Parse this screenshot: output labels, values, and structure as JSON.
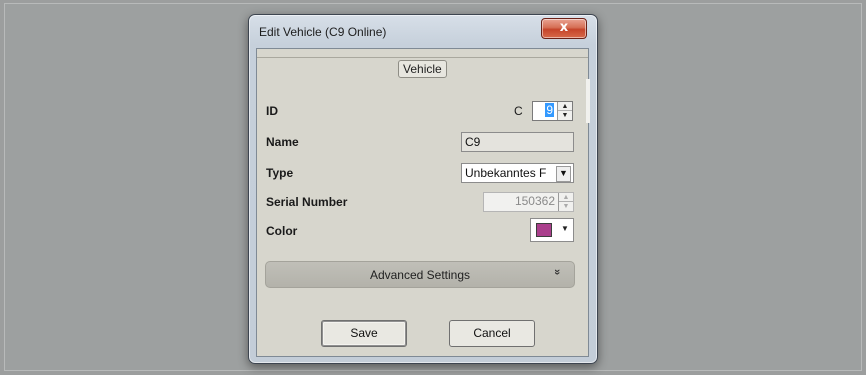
{
  "window": {
    "title": "Edit Vehicle (C9 Online)",
    "close_label": "x"
  },
  "group": {
    "label": "Vehicle"
  },
  "fields": {
    "id": {
      "label": "ID",
      "prefix": "C",
      "value": "9"
    },
    "name": {
      "label": "Name",
      "value": "C9"
    },
    "type": {
      "label": "Type",
      "value": "Unbekanntes F"
    },
    "serial": {
      "label": "Serial Number",
      "value": "150362"
    },
    "color": {
      "label": "Color",
      "value": "#aa3f8c"
    }
  },
  "advanced": {
    "label": "Advanced Settings",
    "icon": "double-chevron-down-icon"
  },
  "buttons": {
    "save": "Save",
    "cancel": "Cancel"
  }
}
